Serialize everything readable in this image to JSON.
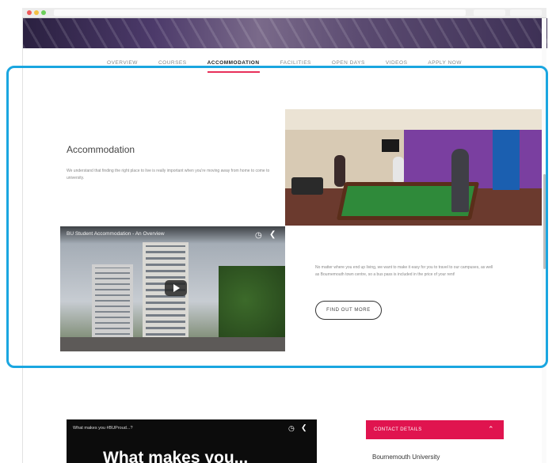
{
  "nav": {
    "items": [
      "OVERVIEW",
      "COURSES",
      "ACCOMMODATION",
      "FACILITIES",
      "OPEN DAYS",
      "VIDEOS",
      "APPLY NOW"
    ],
    "active": "ACCOMMODATION"
  },
  "accommodation": {
    "title": "Accommodation",
    "intro": "We understand that finding the right place to live is really important when you're moving away from home to come to university.",
    "body": "No matter where you end up living, we want to make it easy for you to travel to our campuses, as well as Bournemouth town centre, so a bus pass is included in the price of your rent!",
    "button": "FIND OUT MORE"
  },
  "video1": {
    "title": "BU Student Accommodation - An Overview"
  },
  "video2": {
    "title": "What makes you #BUProud...?",
    "overlay": "What makes you..."
  },
  "contact": {
    "header": "CONTACT DETAILS",
    "name": "Bournemouth University"
  },
  "colors": {
    "accent": "#e0144f",
    "highlight": "#1aa6e0",
    "nav_underline": "#e8305a"
  },
  "icons": {
    "clock": "clock-icon",
    "share": "share-icon",
    "play": "play-icon",
    "chevron": "chevron-up-icon"
  }
}
